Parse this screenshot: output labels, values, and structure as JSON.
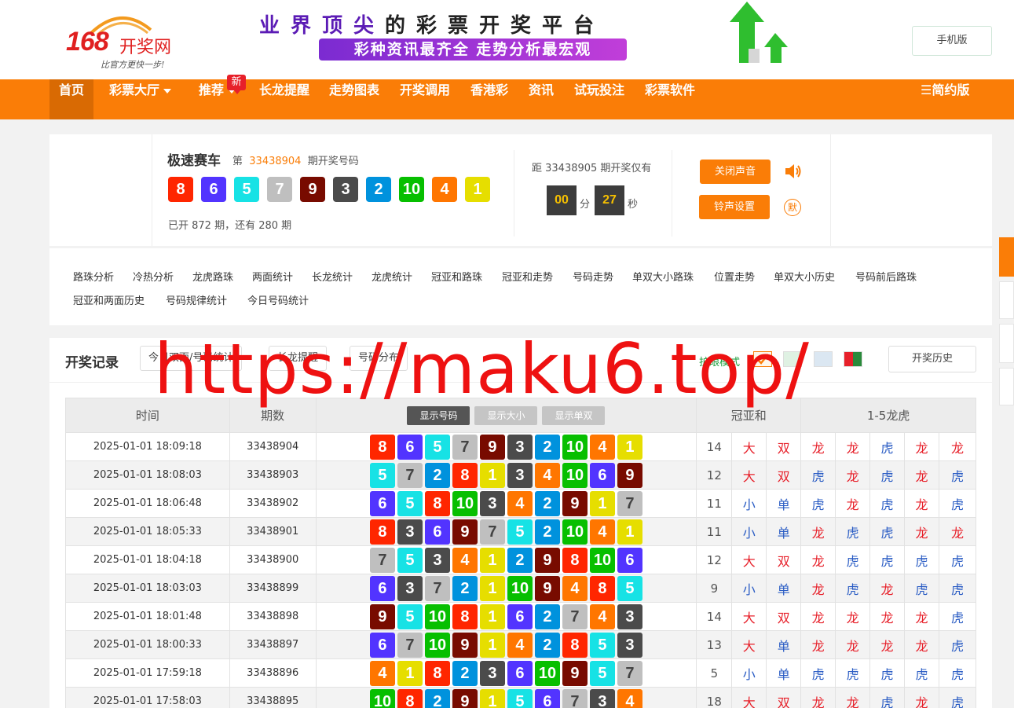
{
  "header": {
    "logo_num": "168",
    "logo_word": "开奖网",
    "logo_slogan": "比官方更快一步!",
    "banner_line1_a": "业界顶尖",
    "banner_line1_b": "的彩票开奖平台",
    "banner_line2": "彩种资讯最齐全  走势分析最宏观",
    "mobile_label": "手机版"
  },
  "nav": {
    "items": [
      "首页",
      "彩票大厅",
      "推荐",
      "长龙提醒",
      "走势图表",
      "开奖调用",
      "香港彩",
      "资讯",
      "试玩投注",
      "彩票软件"
    ],
    "new_badge": "新",
    "simple_mode": "☰简约版"
  },
  "draw": {
    "game_name": "极速赛车",
    "issue_prefix": "第",
    "issue": "33438904",
    "issue_suffix": "期开奖号码",
    "numbers": [
      8,
      6,
      5,
      7,
      9,
      3,
      2,
      10,
      4,
      1
    ],
    "opened_text": "已开 872 期，还有 280 期",
    "next_text": "距 33438905 期开奖仅有",
    "minutes": "00",
    "minute_unit": "分",
    "seconds": "27",
    "second_unit": "秒",
    "sound_off_label": "关闭声音",
    "ring_label": "铃声设置",
    "mute_label": "默"
  },
  "links": [
    "路珠分析",
    "冷热分析",
    "龙虎路珠",
    "两面统计",
    "长龙统计",
    "龙虎统计",
    "冠亚和路珠",
    "冠亚和走势",
    "号码走势",
    "单双大小路珠",
    "位置走势",
    "单双大小历史",
    "号码前后路珠",
    "冠亚和两面历史",
    "号码规律统计",
    "今日号码统计"
  ],
  "records": {
    "title": "开奖记录",
    "btn_today": "今日双面/号码统计",
    "btn_long": "长龙提醒",
    "btn_dist": "号码分布",
    "eye_mode": "护眼模式",
    "history_btn": "开奖历史",
    "col_time": "时间",
    "col_issue": "期数",
    "toggle_num": "显示号码",
    "toggle_size": "显示大小",
    "toggle_odd": "显示单双",
    "col_sum": "冠亚和",
    "col_dragon": "1-5龙虎",
    "rows": [
      {
        "time": "2025-01-01 18:09:18",
        "issue": "33438904",
        "nums": [
          8,
          6,
          5,
          7,
          9,
          3,
          2,
          10,
          4,
          1
        ],
        "sum": "14",
        "size": "大",
        "odd": "双",
        "dt": [
          "龙",
          "龙",
          "虎",
          "龙",
          "龙"
        ]
      },
      {
        "time": "2025-01-01 18:08:03",
        "issue": "33438903",
        "nums": [
          5,
          7,
          2,
          8,
          1,
          3,
          4,
          10,
          6,
          9
        ],
        "sum": "12",
        "size": "大",
        "odd": "双",
        "dt": [
          "虎",
          "龙",
          "虎",
          "龙",
          "虎"
        ]
      },
      {
        "time": "2025-01-01 18:06:48",
        "issue": "33438902",
        "nums": [
          6,
          5,
          8,
          10,
          3,
          4,
          2,
          9,
          1,
          7
        ],
        "sum": "11",
        "size": "小",
        "odd": "单",
        "dt": [
          "虎",
          "龙",
          "虎",
          "龙",
          "虎"
        ]
      },
      {
        "time": "2025-01-01 18:05:33",
        "issue": "33438901",
        "nums": [
          8,
          3,
          6,
          9,
          7,
          5,
          2,
          10,
          4,
          1
        ],
        "sum": "11",
        "size": "小",
        "odd": "单",
        "dt": [
          "龙",
          "虎",
          "虎",
          "龙",
          "龙"
        ]
      },
      {
        "time": "2025-01-01 18:04:18",
        "issue": "33438900",
        "nums": [
          7,
          5,
          3,
          4,
          1,
          2,
          9,
          8,
          10,
          6
        ],
        "sum": "12",
        "size": "大",
        "odd": "双",
        "dt": [
          "龙",
          "虎",
          "虎",
          "虎",
          "虎"
        ]
      },
      {
        "time": "2025-01-01 18:03:03",
        "issue": "33438899",
        "nums": [
          6,
          3,
          7,
          2,
          1,
          10,
          9,
          4,
          8,
          5
        ],
        "sum": "9",
        "size": "小",
        "odd": "单",
        "dt": [
          "龙",
          "虎",
          "龙",
          "虎",
          "虎"
        ]
      },
      {
        "time": "2025-01-01 18:01:48",
        "issue": "33438898",
        "nums": [
          9,
          5,
          10,
          8,
          1,
          6,
          2,
          7,
          4,
          3
        ],
        "sum": "14",
        "size": "大",
        "odd": "双",
        "dt": [
          "龙",
          "龙",
          "龙",
          "龙",
          "虎"
        ]
      },
      {
        "time": "2025-01-01 18:00:33",
        "issue": "33438897",
        "nums": [
          6,
          7,
          10,
          9,
          1,
          4,
          2,
          8,
          5,
          3
        ],
        "sum": "13",
        "size": "大",
        "odd": "单",
        "dt": [
          "龙",
          "龙",
          "龙",
          "龙",
          "虎"
        ]
      },
      {
        "time": "2025-01-01 17:59:18",
        "issue": "33438896",
        "nums": [
          4,
          1,
          8,
          2,
          3,
          6,
          10,
          9,
          5,
          7
        ],
        "sum": "5",
        "size": "小",
        "odd": "单",
        "dt": [
          "虎",
          "虎",
          "虎",
          "虎",
          "虎"
        ]
      },
      {
        "time": "2025-01-01 17:58:03",
        "issue": "33438895",
        "nums": [
          10,
          8,
          2,
          9,
          1,
          5,
          6,
          7,
          3,
          4
        ],
        "sum": "18",
        "size": "大",
        "odd": "双",
        "dt": [
          "龙",
          "龙",
          "虎",
          "龙",
          "虎"
        ]
      }
    ]
  },
  "watermark": "https://maku6.top/",
  "colors": {
    "orange": "#fa7d07",
    "ball_1": "#e6de00",
    "ball_2": "#0092dd",
    "ball_3": "#4b4b4b",
    "ball_4": "#ff7600",
    "ball_5": "#17e2e5",
    "ball_6": "#5234ff",
    "ball_7": "#bfbfbf",
    "ball_8": "#ff2600",
    "ball_9": "#780b00",
    "ball_10": "#07bf00"
  },
  "icons": [
    "speaker-icon",
    "menu-icon",
    "check-icon"
  ]
}
